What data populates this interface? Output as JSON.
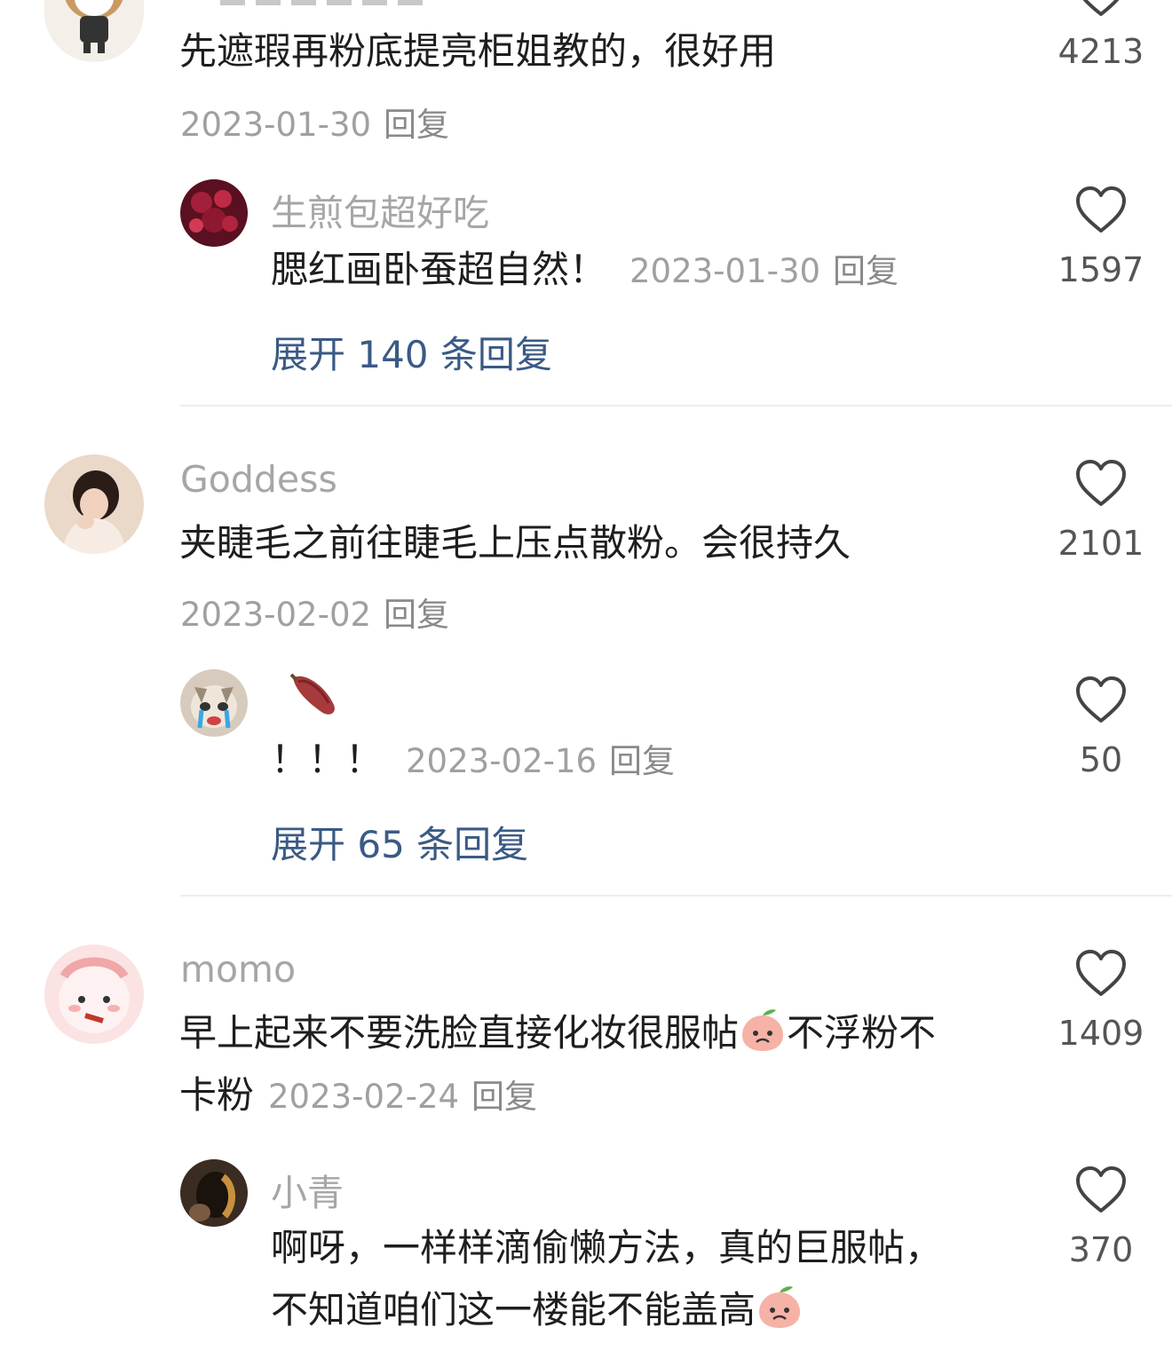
{
  "reply_label": "回复",
  "comments": [
    {
      "text": "先遮瑕再粉底提亮柜姐教的，很好用",
      "date": "2023-01-30",
      "likes": "4213",
      "sub": {
        "username": "生煎包超好吃",
        "text": "腮红画卧蚕超自然！",
        "date": "2023-01-30",
        "likes": "1597"
      },
      "expand": "展开 140 条回复"
    },
    {
      "username": "Goddess",
      "text": "夹睫毛之前往睫毛上压点散粉。会很持久",
      "date": "2023-02-02",
      "likes": "2101",
      "sub": {
        "username": "",
        "text": "！！！",
        "date": "2023-02-16",
        "likes": "50"
      },
      "expand": "展开 65 条回复"
    },
    {
      "username": "momo",
      "text_line1_a": "早上起来不要洗脸直接化妆很服帖",
      "text_line1_b": "不浮粉不",
      "text_line2": "卡粉",
      "date": "2023-02-24",
      "likes": "1409",
      "sub": {
        "username": "小青",
        "text_line1": "啊呀，一样样滴偷懒方法，真的巨服帖，",
        "text_line2": "不知道咱们这一楼能不能盖高",
        "likes": "370"
      }
    }
  ],
  "icons": {
    "like": "heart-outline-icon",
    "sweet_potato": "sweet-potato-emoji",
    "peach_face": "peach-face-emoji"
  }
}
